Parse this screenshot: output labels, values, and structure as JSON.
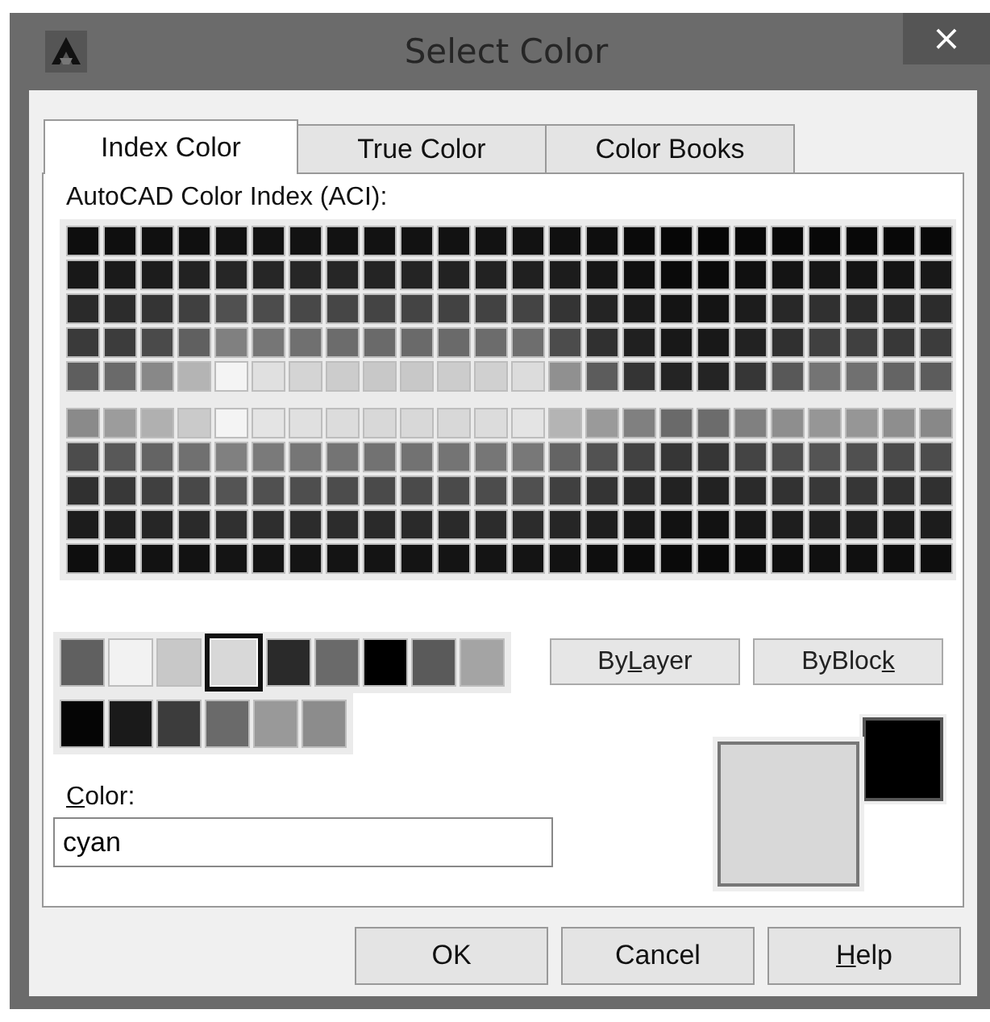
{
  "window": {
    "title": "Select Color",
    "close": "×"
  },
  "tabs": [
    {
      "label": "Index Color",
      "selected": true
    },
    {
      "label": "True Color",
      "selected": false
    },
    {
      "label": "Color Books",
      "selected": false
    }
  ],
  "aci": {
    "label": "AutoCAD Color Index (ACI):",
    "rows_top": [
      [
        {
          "color": "#0e0e0e"
        },
        {
          "color": "#0f0f0f"
        },
        {
          "color": "#101010"
        },
        {
          "color": "#101010"
        },
        {
          "color": "#121212"
        },
        {
          "color": "#121212"
        },
        {
          "color": "#121212"
        },
        {
          "color": "#121212"
        },
        {
          "color": "#121212"
        },
        {
          "color": "#121212"
        },
        {
          "color": "#121212"
        },
        {
          "color": "#121212"
        },
        {
          "color": "#121212"
        },
        {
          "color": "#101010"
        },
        {
          "color": "#0e0e0e"
        },
        {
          "color": "#0a0a0a"
        },
        {
          "color": "#060606"
        },
        {
          "color": "#060606"
        },
        {
          "color": "#080808"
        },
        {
          "color": "#080808"
        },
        {
          "color": "#080808"
        },
        {
          "color": "#080808"
        },
        {
          "color": "#080808"
        },
        {
          "color": "#080808"
        }
      ],
      [
        {
          "color": "#181818"
        },
        {
          "color": "#1a1a1a"
        },
        {
          "color": "#1c1c1c"
        },
        {
          "color": "#222222"
        },
        {
          "color": "#262626"
        },
        {
          "color": "#262626"
        },
        {
          "color": "#262626"
        },
        {
          "color": "#262626"
        },
        {
          "color": "#242424"
        },
        {
          "color": "#242424"
        },
        {
          "color": "#222222"
        },
        {
          "color": "#222222"
        },
        {
          "color": "#202020"
        },
        {
          "color": "#1c1c1c"
        },
        {
          "color": "#161616"
        },
        {
          "color": "#101010"
        },
        {
          "color": "#0a0a0a"
        },
        {
          "color": "#0a0a0a"
        },
        {
          "color": "#101010"
        },
        {
          "color": "#141414"
        },
        {
          "color": "#161616"
        },
        {
          "color": "#141414"
        },
        {
          "color": "#141414"
        },
        {
          "color": "#181818"
        }
      ],
      [
        {
          "color": "#2a2a2a"
        },
        {
          "color": "#2c2c2c"
        },
        {
          "color": "#343434"
        },
        {
          "color": "#404040"
        },
        {
          "color": "#505050"
        },
        {
          "color": "#4c4c4c"
        },
        {
          "color": "#484848"
        },
        {
          "color": "#464646"
        },
        {
          "color": "#444444"
        },
        {
          "color": "#444444"
        },
        {
          "color": "#424242"
        },
        {
          "color": "#424242"
        },
        {
          "color": "#444444"
        },
        {
          "color": "#343434"
        },
        {
          "color": "#242424"
        },
        {
          "color": "#1a1a1a"
        },
        {
          "color": "#141414"
        },
        {
          "color": "#141414"
        },
        {
          "color": "#1c1c1c"
        },
        {
          "color": "#282828"
        },
        {
          "color": "#303030"
        },
        {
          "color": "#2a2a2a"
        },
        {
          "color": "#262626"
        },
        {
          "color": "#2c2c2c"
        }
      ],
      [
        {
          "color": "#3a3a3a"
        },
        {
          "color": "#3c3c3c"
        },
        {
          "color": "#4a4a4a"
        },
        {
          "color": "#606060"
        },
        {
          "color": "#808080"
        },
        {
          "color": "#767676"
        },
        {
          "color": "#707070"
        },
        {
          "color": "#6c6c6c"
        },
        {
          "color": "#6a6a6a"
        },
        {
          "color": "#6a6a6a"
        },
        {
          "color": "#6a6a6a"
        },
        {
          "color": "#6c6c6c"
        },
        {
          "color": "#6e6e6e"
        },
        {
          "color": "#4c4c4c"
        },
        {
          "color": "#303030"
        },
        {
          "color": "#202020"
        },
        {
          "color": "#181818"
        },
        {
          "color": "#181818"
        },
        {
          "color": "#222222"
        },
        {
          "color": "#303030"
        },
        {
          "color": "#404040"
        },
        {
          "color": "#404040"
        },
        {
          "color": "#383838"
        },
        {
          "color": "#3c3c3c"
        }
      ],
      [
        {
          "color": "#5e5e5e"
        },
        {
          "color": "#6a6a6a"
        },
        {
          "color": "#888888"
        },
        {
          "color": "#b4b4b4"
        },
        {
          "color": "#f4f4f4"
        },
        {
          "color": "#e0e0e0"
        },
        {
          "color": "#d4d4d4"
        },
        {
          "color": "#cccccc"
        },
        {
          "color": "#c8c8c8"
        },
        {
          "color": "#c8c8c8"
        },
        {
          "color": "#cccccc"
        },
        {
          "color": "#d0d0d0"
        },
        {
          "color": "#dcdcdc"
        },
        {
          "color": "#909090"
        },
        {
          "color": "#5c5c5c"
        },
        {
          "color": "#343434"
        },
        {
          "color": "#242424"
        },
        {
          "color": "#242424"
        },
        {
          "color": "#363636"
        },
        {
          "color": "#585858"
        },
        {
          "color": "#747474"
        },
        {
          "color": "#707070"
        },
        {
          "color": "#646464"
        },
        {
          "color": "#5c5c5c"
        }
      ]
    ],
    "rows_bottom": [
      [
        {
          "color": "#8a8a8a"
        },
        {
          "color": "#9c9c9c"
        },
        {
          "color": "#b0b0b0"
        },
        {
          "color": "#cacaca"
        },
        {
          "color": "#f4f4f4"
        },
        {
          "color": "#e4e4e4"
        },
        {
          "color": "#e0e0e0"
        },
        {
          "color": "#dcdcdc"
        },
        {
          "color": "#d8d8d8"
        },
        {
          "color": "#d8d8d8"
        },
        {
          "color": "#d8d8d8"
        },
        {
          "color": "#dcdcdc"
        },
        {
          "color": "#e4e4e4"
        },
        {
          "color": "#b4b4b4"
        },
        {
          "color": "#9a9a9a"
        },
        {
          "color": "#808080"
        },
        {
          "color": "#6a6a6a"
        },
        {
          "color": "#6c6c6c"
        },
        {
          "color": "#808080"
        },
        {
          "color": "#8e8e8e"
        },
        {
          "color": "#969696"
        },
        {
          "color": "#969696"
        },
        {
          "color": "#8e8e8e"
        },
        {
          "color": "#888888"
        }
      ],
      [
        {
          "color": "#4c4c4c"
        },
        {
          "color": "#585858"
        },
        {
          "color": "#646464"
        },
        {
          "color": "#707070"
        },
        {
          "color": "#808080"
        },
        {
          "color": "#7a7a7a"
        },
        {
          "color": "#767676"
        },
        {
          "color": "#747474"
        },
        {
          "color": "#727272"
        },
        {
          "color": "#727272"
        },
        {
          "color": "#747474"
        },
        {
          "color": "#767676"
        },
        {
          "color": "#787878"
        },
        {
          "color": "#646464"
        },
        {
          "color": "#525252"
        },
        {
          "color": "#424242"
        },
        {
          "color": "#363636"
        },
        {
          "color": "#363636"
        },
        {
          "color": "#444444"
        },
        {
          "color": "#4e4e4e"
        },
        {
          "color": "#545454"
        },
        {
          "color": "#505050"
        },
        {
          "color": "#4a4a4a"
        },
        {
          "color": "#4c4c4c"
        }
      ],
      [
        {
          "color": "#303030"
        },
        {
          "color": "#383838"
        },
        {
          "color": "#404040"
        },
        {
          "color": "#484848"
        },
        {
          "color": "#545454"
        },
        {
          "color": "#505050"
        },
        {
          "color": "#4e4e4e"
        },
        {
          "color": "#4c4c4c"
        },
        {
          "color": "#4a4a4a"
        },
        {
          "color": "#4a4a4a"
        },
        {
          "color": "#4a4a4a"
        },
        {
          "color": "#4c4c4c"
        },
        {
          "color": "#505050"
        },
        {
          "color": "#404040"
        },
        {
          "color": "#343434"
        },
        {
          "color": "#2a2a2a"
        },
        {
          "color": "#222222"
        },
        {
          "color": "#222222"
        },
        {
          "color": "#2a2a2a"
        },
        {
          "color": "#323232"
        },
        {
          "color": "#383838"
        },
        {
          "color": "#363636"
        },
        {
          "color": "#303030"
        },
        {
          "color": "#303030"
        }
      ],
      [
        {
          "color": "#1c1c1c"
        },
        {
          "color": "#202020"
        },
        {
          "color": "#262626"
        },
        {
          "color": "#2a2a2a"
        },
        {
          "color": "#303030"
        },
        {
          "color": "#2e2e2e"
        },
        {
          "color": "#2c2c2c"
        },
        {
          "color": "#2c2c2c"
        },
        {
          "color": "#2a2a2a"
        },
        {
          "color": "#2a2a2a"
        },
        {
          "color": "#2a2a2a"
        },
        {
          "color": "#2c2c2c"
        },
        {
          "color": "#2c2c2c"
        },
        {
          "color": "#262626"
        },
        {
          "color": "#1e1e1e"
        },
        {
          "color": "#181818"
        },
        {
          "color": "#121212"
        },
        {
          "color": "#121212"
        },
        {
          "color": "#181818"
        },
        {
          "color": "#1e1e1e"
        },
        {
          "color": "#202020"
        },
        {
          "color": "#202020"
        },
        {
          "color": "#1c1c1c"
        },
        {
          "color": "#1c1c1c"
        }
      ],
      [
        {
          "color": "#0e0e0e"
        },
        {
          "color": "#101010"
        },
        {
          "color": "#121212"
        },
        {
          "color": "#121212"
        },
        {
          "color": "#141414"
        },
        {
          "color": "#141414"
        },
        {
          "color": "#141414"
        },
        {
          "color": "#141414"
        },
        {
          "color": "#141414"
        },
        {
          "color": "#141414"
        },
        {
          "color": "#141414"
        },
        {
          "color": "#141414"
        },
        {
          "color": "#141414"
        },
        {
          "color": "#121212"
        },
        {
          "color": "#0e0e0e"
        },
        {
          "color": "#0c0c0c"
        },
        {
          "color": "#0a0a0a"
        },
        {
          "color": "#0a0a0a"
        },
        {
          "color": "#0c0c0c"
        },
        {
          "color": "#0e0e0e"
        },
        {
          "color": "#101010"
        },
        {
          "color": "#101010"
        },
        {
          "color": "#0e0e0e"
        },
        {
          "color": "#0e0e0e"
        }
      ]
    ]
  },
  "standard_colors": [
    {
      "color": "#606060",
      "selected": false
    },
    {
      "color": "#f2f2f2",
      "selected": false
    },
    {
      "color": "#c8c8c8",
      "selected": false
    },
    {
      "color": "#d8d8d8",
      "selected": true
    },
    {
      "color": "#2a2a2a",
      "selected": false
    },
    {
      "color": "#6a6a6a",
      "selected": false
    },
    {
      "color": "#000000",
      "selected": false
    },
    {
      "color": "#5a5a5a",
      "selected": false
    },
    {
      "color": "#a4a4a4",
      "selected": false
    }
  ],
  "shade_colors": [
    {
      "color": "#050505",
      "selected": false
    },
    {
      "color": "#1a1a1a",
      "selected": false
    },
    {
      "color": "#3c3c3c",
      "selected": false
    },
    {
      "color": "#6a6a6a",
      "selected": false
    },
    {
      "color": "#999999",
      "selected": false
    },
    {
      "color": "#8c8c8c",
      "selected": false
    }
  ],
  "by_buttons": [
    {
      "label_parts": [
        {
          "text": "By"
        },
        {
          "text": "L",
          "underlined": true
        },
        {
          "text": "ayer"
        }
      ]
    },
    {
      "label_parts": [
        {
          "text": "ByBloc"
        },
        {
          "text": "k",
          "underlined": true
        }
      ]
    }
  ],
  "color_field": {
    "label_parts": [
      {
        "text": "C",
        "underlined": true
      },
      {
        "text": "olor:"
      }
    ],
    "value": "cyan"
  },
  "preview": [
    {
      "kind": "previous",
      "color": "#000000"
    },
    {
      "kind": "current",
      "color": "#d8d8d8"
    }
  ],
  "buttons": [
    {
      "label_parts": [
        {
          "text": "OK"
        }
      ]
    },
    {
      "label_parts": [
        {
          "text": "Cancel"
        }
      ]
    },
    {
      "label_parts": [
        {
          "text": "H",
          "underlined": true
        },
        {
          "text": "elp"
        }
      ]
    }
  ]
}
